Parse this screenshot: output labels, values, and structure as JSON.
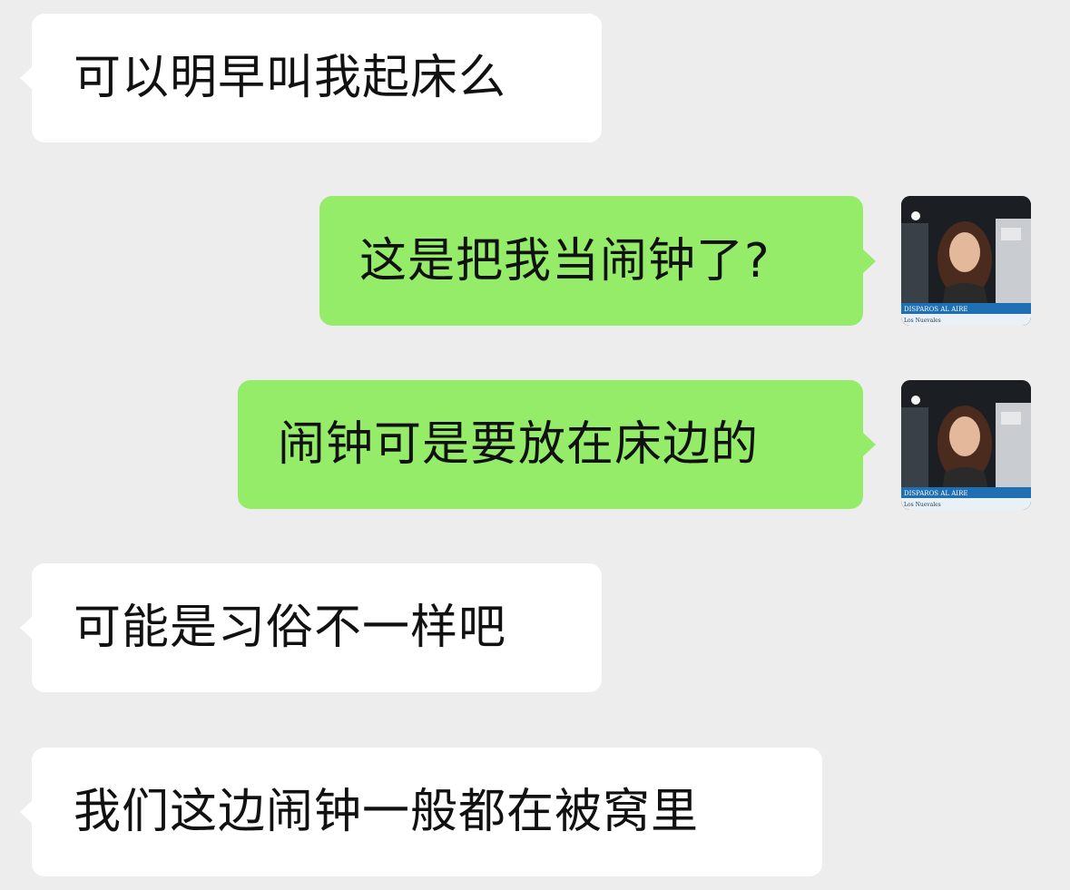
{
  "chat": {
    "messages": [
      {
        "side": "in",
        "text": "可以明早叫我起床么"
      },
      {
        "side": "out",
        "text": "这是把我当闹钟了?"
      },
      {
        "side": "out",
        "text": "闹钟可是要放在床边的"
      },
      {
        "side": "in",
        "text": "可能是习俗不一样吧"
      },
      {
        "side": "in",
        "text": "我们这边闹钟一般都在被窝里"
      }
    ],
    "avatar": {
      "caption_line1": "DISPAROS AL AIRE",
      "caption_line2": "Los Nuevales"
    }
  },
  "colors": {
    "background": "#ededed",
    "incoming_bubble": "#ffffff",
    "outgoing_bubble": "#95ec69",
    "text": "#111111"
  }
}
